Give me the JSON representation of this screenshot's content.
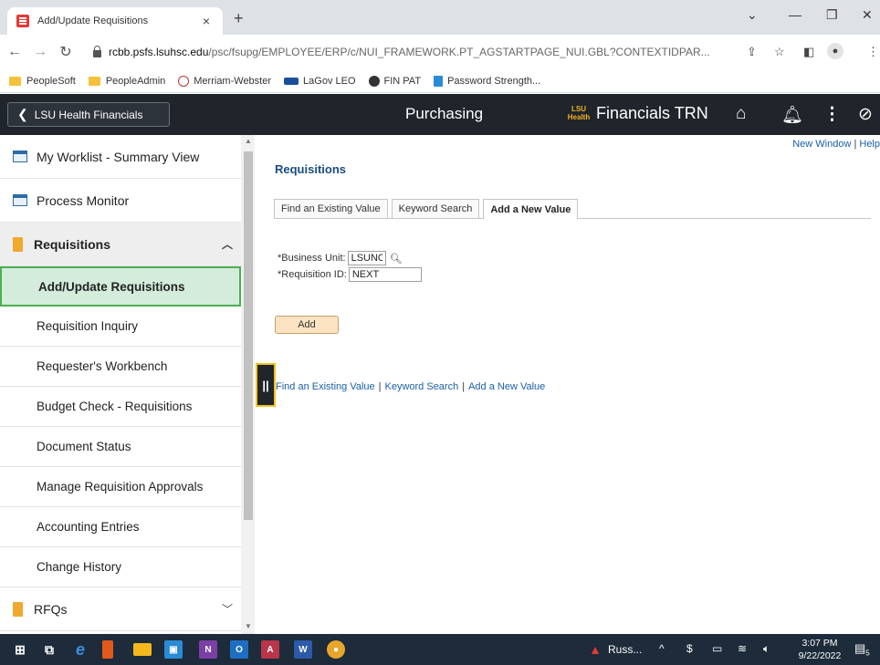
{
  "browser": {
    "tab_title": "Add/Update Requisitions",
    "tab_close": "×",
    "new_tab": "+",
    "url_host": "rcbb.psfs.lsuhsc.edu",
    "url_path": "/psc/fsupg/EMPLOYEE/ERP/c/NUI_FRAMEWORK.PT_AGSTARTPAGE_NUI.GBL?CONTEXTIDPAR...",
    "bookmarks": [
      "PeopleSoft",
      "PeopleAdmin",
      "Merriam-Webster",
      "LaGov LEO",
      "FIN PAT",
      "Password Strength..."
    ]
  },
  "header": {
    "home_label": "LSU Health Financials",
    "title": "Purchasing",
    "brand": "Financials TRN",
    "logo_top": "LSU",
    "logo_bottom": "Health"
  },
  "sidebar": {
    "items": [
      {
        "label": "My Worklist - Summary View"
      },
      {
        "label": "Process Monitor"
      },
      {
        "label": "Requisitions"
      },
      {
        "label": "Add/Update Requisitions"
      },
      {
        "label": "Requisition Inquiry"
      },
      {
        "label": "Requester's Workbench"
      },
      {
        "label": "Budget Check - Requisitions"
      },
      {
        "label": "Document Status"
      },
      {
        "label": "Manage Requisition Approvals"
      },
      {
        "label": "Accounting Entries"
      },
      {
        "label": "Change History"
      },
      {
        "label": "RFQs"
      }
    ]
  },
  "content": {
    "top_link_new_window": "New Window",
    "top_link_help": "Help",
    "page_title": "Requisitions",
    "tabs": [
      {
        "label": "Find an Existing Value"
      },
      {
        "label": "Keyword Search"
      },
      {
        "label": "Add a New Value"
      }
    ],
    "business_unit_label": "*Business Unit:",
    "business_unit_value": "LSUNO",
    "requisition_id_label": "*Requisition ID:",
    "requisition_id_value": "NEXT",
    "add_button": "Add",
    "bottom_links": [
      "Find an Existing Value",
      "Keyword Search",
      "Add a New Value"
    ]
  },
  "taskbar": {
    "weather": "Russ...",
    "time": "3:07 PM",
    "date": "9/22/2022",
    "notifications": "5"
  }
}
